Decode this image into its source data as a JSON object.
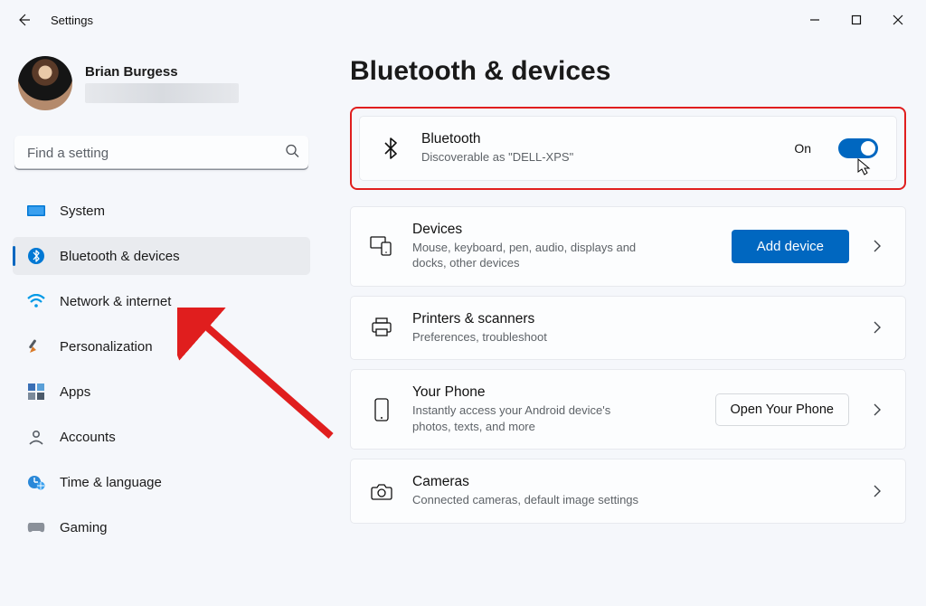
{
  "window": {
    "title": "Settings"
  },
  "profile": {
    "name": "Brian Burgess"
  },
  "search": {
    "placeholder": "Find a setting"
  },
  "nav": {
    "system": "System",
    "bluetooth": "Bluetooth & devices",
    "network": "Network & internet",
    "personalization": "Personalization",
    "apps": "Apps",
    "accounts": "Accounts",
    "time": "Time & language",
    "gaming": "Gaming"
  },
  "page": {
    "title": "Bluetooth & devices"
  },
  "bluetooth_card": {
    "title": "Bluetooth",
    "subtitle": "Discoverable as \"DELL-XPS\"",
    "state_label": "On"
  },
  "devices_card": {
    "title": "Devices",
    "subtitle": "Mouse, keyboard, pen, audio, displays and docks, other devices",
    "button": "Add device"
  },
  "printers_card": {
    "title": "Printers & scanners",
    "subtitle": "Preferences, troubleshoot"
  },
  "phone_card": {
    "title": "Your Phone",
    "subtitle": "Instantly access your Android device's photos, texts, and more",
    "button": "Open Your Phone"
  },
  "cameras_card": {
    "title": "Cameras",
    "subtitle": "Connected cameras, default image settings"
  }
}
